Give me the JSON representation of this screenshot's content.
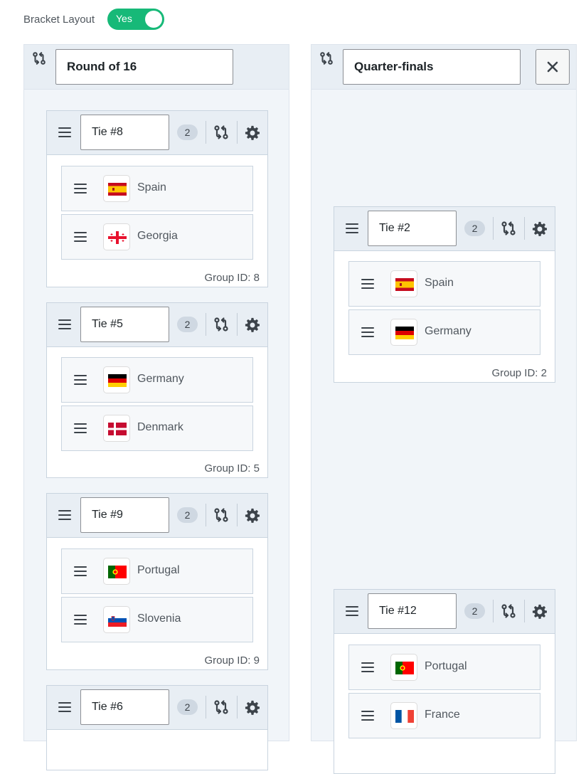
{
  "bracket_layout": {
    "label": "Bracket Layout",
    "toggle": "Yes"
  },
  "columns": [
    {
      "title": "Round of 16",
      "ties": [
        {
          "name": "Tie #8",
          "count": "2",
          "group_label": "Group ID: 8",
          "teams": [
            {
              "name": "Spain",
              "flag": "spain-flag-icon"
            },
            {
              "name": "Georgia",
              "flag": "georgia-flag-icon"
            }
          ]
        },
        {
          "name": "Tie #5",
          "count": "2",
          "group_label": "Group ID: 5",
          "teams": [
            {
              "name": "Germany",
              "flag": "germany-flag-icon"
            },
            {
              "name": "Denmark",
              "flag": "denmark-flag-icon"
            }
          ]
        },
        {
          "name": "Tie #9",
          "count": "2",
          "group_label": "Group ID: 9",
          "teams": [
            {
              "name": "Portugal",
              "flag": "portugal-flag-icon"
            },
            {
              "name": "Slovenia",
              "flag": "slovenia-flag-icon"
            }
          ]
        },
        {
          "name": "Tie #6",
          "count": "2"
        }
      ]
    },
    {
      "title": "Quarter-finals",
      "ties": [
        {
          "name": "Tie #2",
          "count": "2",
          "group_label": "Group ID: 2",
          "teams": [
            {
              "name": "Spain",
              "flag": "spain-flag-icon"
            },
            {
              "name": "Germany",
              "flag": "germany-flag-icon"
            }
          ]
        },
        {
          "name": "Tie #12",
          "count": "2",
          "teams": [
            {
              "name": "Portugal",
              "flag": "portugal-flag-icon"
            },
            {
              "name": "France",
              "flag": "france-flag-icon"
            }
          ]
        }
      ]
    }
  ],
  "colors": {
    "toggle_on": "#17b978",
    "panel_bg": "#f1f5f9",
    "header_bg": "#e8eef4",
    "border": "#c9d4df"
  }
}
